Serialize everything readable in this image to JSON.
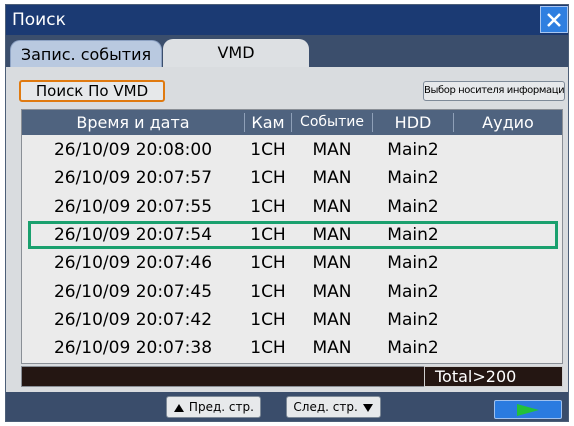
{
  "window": {
    "title": "Поиск"
  },
  "tabs": [
    {
      "label": "Запис. события"
    },
    {
      "label": "VMD"
    }
  ],
  "toolbar": {
    "vmd_search_label": "Поиск По VMD",
    "media_select_label": "Выбор носителя информации"
  },
  "table": {
    "headers": [
      "Время и дата",
      "Кам",
      "Событие",
      "HDD",
      "Аудио"
    ],
    "rows": [
      {
        "datetime": "26/10/09 20:08:00",
        "cam": "1CH",
        "event": "MAN",
        "hdd": "Main2",
        "audio": ""
      },
      {
        "datetime": "26/10/09 20:07:57",
        "cam": "1CH",
        "event": "MAN",
        "hdd": "Main2",
        "audio": ""
      },
      {
        "datetime": "26/10/09 20:07:55",
        "cam": "1CH",
        "event": "MAN",
        "hdd": "Main2",
        "audio": ""
      },
      {
        "datetime": "26/10/09 20:07:54",
        "cam": "1CH",
        "event": "MAN",
        "hdd": "Main2",
        "audio": ""
      },
      {
        "datetime": "26/10/09 20:07:46",
        "cam": "1CH",
        "event": "MAN",
        "hdd": "Main2",
        "audio": ""
      },
      {
        "datetime": "26/10/09 20:07:45",
        "cam": "1CH",
        "event": "MAN",
        "hdd": "Main2",
        "audio": ""
      },
      {
        "datetime": "26/10/09 20:07:42",
        "cam": "1CH",
        "event": "MAN",
        "hdd": "Main2",
        "audio": ""
      },
      {
        "datetime": "26/10/09 20:07:38",
        "cam": "1CH",
        "event": "MAN",
        "hdd": "Main2",
        "audio": ""
      }
    ],
    "selected_row": 3
  },
  "status": {
    "total": "Total>200"
  },
  "pager": {
    "prev_label": "Пред. стр.",
    "next_label": "След. стр."
  },
  "colors": {
    "title_bar": "#1b3a73",
    "accent_blue": "#2a7be0",
    "selection": "#1aa06e",
    "active_button_border": "#e07a10",
    "play_arrow": "#22c13a"
  },
  "icons": {
    "close": "close-icon",
    "prev": "triangle-up-icon",
    "next": "triangle-down-icon",
    "play": "play-icon"
  }
}
